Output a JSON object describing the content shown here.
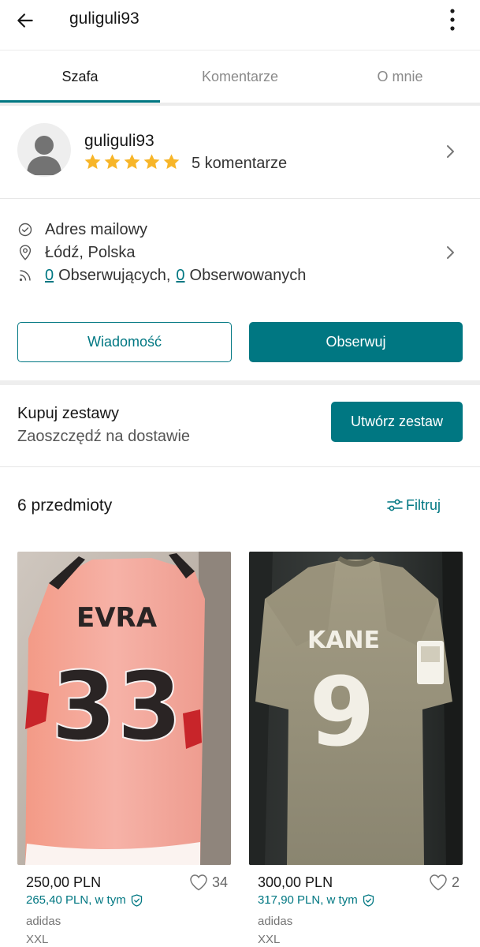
{
  "header": {
    "title": "guliguli93",
    "back_icon": "arrow-left-icon",
    "menu_icon": "more-vertical-icon"
  },
  "tabs": [
    {
      "label": "Szafa",
      "active": true
    },
    {
      "label": "Komentarze",
      "active": false
    },
    {
      "label": "O mnie",
      "active": false
    }
  ],
  "profile": {
    "username": "guliguli93",
    "rating_stars": 5,
    "reviews": "5 komentarze"
  },
  "info": {
    "email": "Adres mailowy",
    "location": "Łódź, Polska",
    "followers_count": "0",
    "followers_label": "Obserwujących,",
    "following_count": "0",
    "following_label": "Obserwowanych"
  },
  "actions": {
    "message": "Wiadomość",
    "follow": "Obserwuj"
  },
  "bundles": {
    "title": "Kupuj zestawy",
    "subtitle": "Zaoszczędź na dostawie",
    "button": "Utwórz zestaw"
  },
  "items_header": {
    "count": "6 przedmioty",
    "filter": "Filtruj"
  },
  "items": [
    {
      "price": "250,00 PLN",
      "likes": "34",
      "total": "265,40 PLN, w tym",
      "brand": "adidas",
      "size": "XXL",
      "photo_name": "EVRA",
      "photo_number": "33"
    },
    {
      "price": "300,00 PLN",
      "likes": "2",
      "total": "317,90 PLN, w tym",
      "brand": "adidas",
      "size": "XXL",
      "photo_name": "KANE",
      "photo_number": "9"
    }
  ],
  "colors": {
    "accent": "#007782",
    "star": "#f7b528"
  }
}
